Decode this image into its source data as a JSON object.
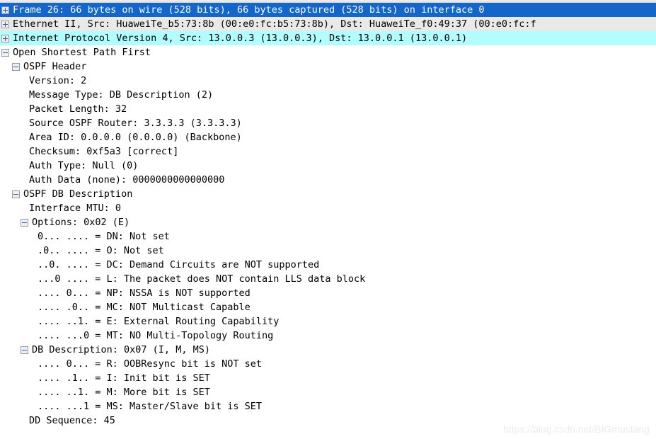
{
  "pane": {
    "name": "packet-details",
    "watermark": "https://blog.csdn.net/BIGmustang"
  },
  "colors": {
    "selection_bg": "#1466c8",
    "selection_fg": "#ffffff",
    "ethernet_row_bg": "#e9e9e9",
    "ip_row_bg": "#b2fdfd",
    "text": "#000000",
    "twisty_glyph": "#3b62a8",
    "watermark": "#ececec"
  },
  "rows": [
    {
      "id": "frame",
      "text": "Frame 26: 66 bytes on wire (528 bits), 66 bytes captured (528 bits) on interface 0",
      "level": 0,
      "toggle": "expand",
      "state": "collapsed",
      "highlight": "selected"
    },
    {
      "id": "ethernet",
      "text": "Ethernet II, Src: HuaweiTe_b5:73:8b (00:e0:fc:b5:73:8b), Dst: HuaweiTe_f0:49:37 (00:e0:fc:f",
      "level": 0,
      "toggle": "expand",
      "state": "collapsed",
      "highlight": "gray"
    },
    {
      "id": "ipv4",
      "text": "Internet Protocol Version 4, Src: 13.0.0.3 (13.0.0.3), Dst: 13.0.0.1 (13.0.0.1)",
      "level": 0,
      "toggle": "expand",
      "state": "collapsed",
      "highlight": "cyan"
    },
    {
      "id": "ospf",
      "text": "Open Shortest Path First",
      "level": 0,
      "toggle": "collapse",
      "state": "expanded",
      "highlight": "none"
    },
    {
      "id": "ospf-header",
      "text": "OSPF Header",
      "level": 1,
      "toggle": "collapse",
      "state": "expanded",
      "highlight": "none"
    },
    {
      "id": "version",
      "text": "Version: 2",
      "level": 2,
      "toggle": "none",
      "highlight": "none"
    },
    {
      "id": "message-type",
      "text": "Message Type: DB Description (2)",
      "level": 2,
      "toggle": "none",
      "highlight": "none"
    },
    {
      "id": "packet-length",
      "text": "Packet Length: 32",
      "level": 2,
      "toggle": "none",
      "highlight": "none"
    },
    {
      "id": "source-router",
      "text": "Source OSPF Router: 3.3.3.3 (3.3.3.3)",
      "level": 2,
      "toggle": "none",
      "highlight": "none"
    },
    {
      "id": "area-id",
      "text": "Area ID: 0.0.0.0 (0.0.0.0) (Backbone)",
      "level": 2,
      "toggle": "none",
      "highlight": "none"
    },
    {
      "id": "checksum",
      "text": "Checksum: 0xf5a3 [correct]",
      "level": 2,
      "toggle": "none",
      "highlight": "none"
    },
    {
      "id": "auth-type",
      "text": "Auth Type: Null (0)",
      "level": 2,
      "toggle": "none",
      "highlight": "none"
    },
    {
      "id": "auth-data",
      "text": "Auth Data (none): 0000000000000000",
      "level": 2,
      "toggle": "none",
      "highlight": "none"
    },
    {
      "id": "ospf-db-description",
      "text": "OSPF DB Description",
      "level": 1,
      "toggle": "collapse",
      "state": "expanded",
      "highlight": "none"
    },
    {
      "id": "interface-mtu",
      "text": "Interface MTU: 0",
      "level": 2,
      "toggle": "none",
      "highlight": "none"
    },
    {
      "id": "options",
      "text": "Options: 0x02 (E)",
      "level": 2,
      "toggle": "collapse",
      "state": "expanded",
      "highlight": "none"
    },
    {
      "id": "opt-dn",
      "text": "0... .... = DN: Not set",
      "level": 3,
      "toggle": "none",
      "highlight": "none"
    },
    {
      "id": "opt-o",
      "text": ".0.. .... = O: Not set",
      "level": 3,
      "toggle": "none",
      "highlight": "none"
    },
    {
      "id": "opt-dc",
      "text": "..0. .... = DC: Demand Circuits are NOT supported",
      "level": 3,
      "toggle": "none",
      "highlight": "none"
    },
    {
      "id": "opt-l",
      "text": "...0 .... = L: The packet does NOT contain LLS data block",
      "level": 3,
      "toggle": "none",
      "highlight": "none"
    },
    {
      "id": "opt-np",
      "text": ".... 0... = NP: NSSA is NOT supported",
      "level": 3,
      "toggle": "none",
      "highlight": "none"
    },
    {
      "id": "opt-mc",
      "text": ".... .0.. = MC: NOT Multicast Capable",
      "level": 3,
      "toggle": "none",
      "highlight": "none"
    },
    {
      "id": "opt-e",
      "text": ".... ..1. = E: External Routing Capability",
      "level": 3,
      "toggle": "none",
      "highlight": "none"
    },
    {
      "id": "opt-mt",
      "text": ".... ...0 = MT: NO Multi-Topology Routing",
      "level": 3,
      "toggle": "none",
      "highlight": "none"
    },
    {
      "id": "db-description",
      "text": "DB Description: 0x07 (I, M, MS)",
      "level": 2,
      "toggle": "collapse",
      "state": "expanded",
      "highlight": "none"
    },
    {
      "id": "dbd-r",
      "text": ".... 0... = R: OOBResync bit is NOT set",
      "level": 3,
      "toggle": "none",
      "highlight": "none"
    },
    {
      "id": "dbd-i",
      "text": ".... .1.. = I: Init bit is SET",
      "level": 3,
      "toggle": "none",
      "highlight": "none"
    },
    {
      "id": "dbd-m",
      "text": ".... ..1. = M: More bit is SET",
      "level": 3,
      "toggle": "none",
      "highlight": "none"
    },
    {
      "id": "dbd-ms",
      "text": ".... ...1 = MS: Master/Slave bit is SET",
      "level": 3,
      "toggle": "none",
      "highlight": "none"
    },
    {
      "id": "dd-sequence",
      "text": "DD Sequence: 45",
      "level": 2,
      "toggle": "none",
      "highlight": "none"
    }
  ]
}
